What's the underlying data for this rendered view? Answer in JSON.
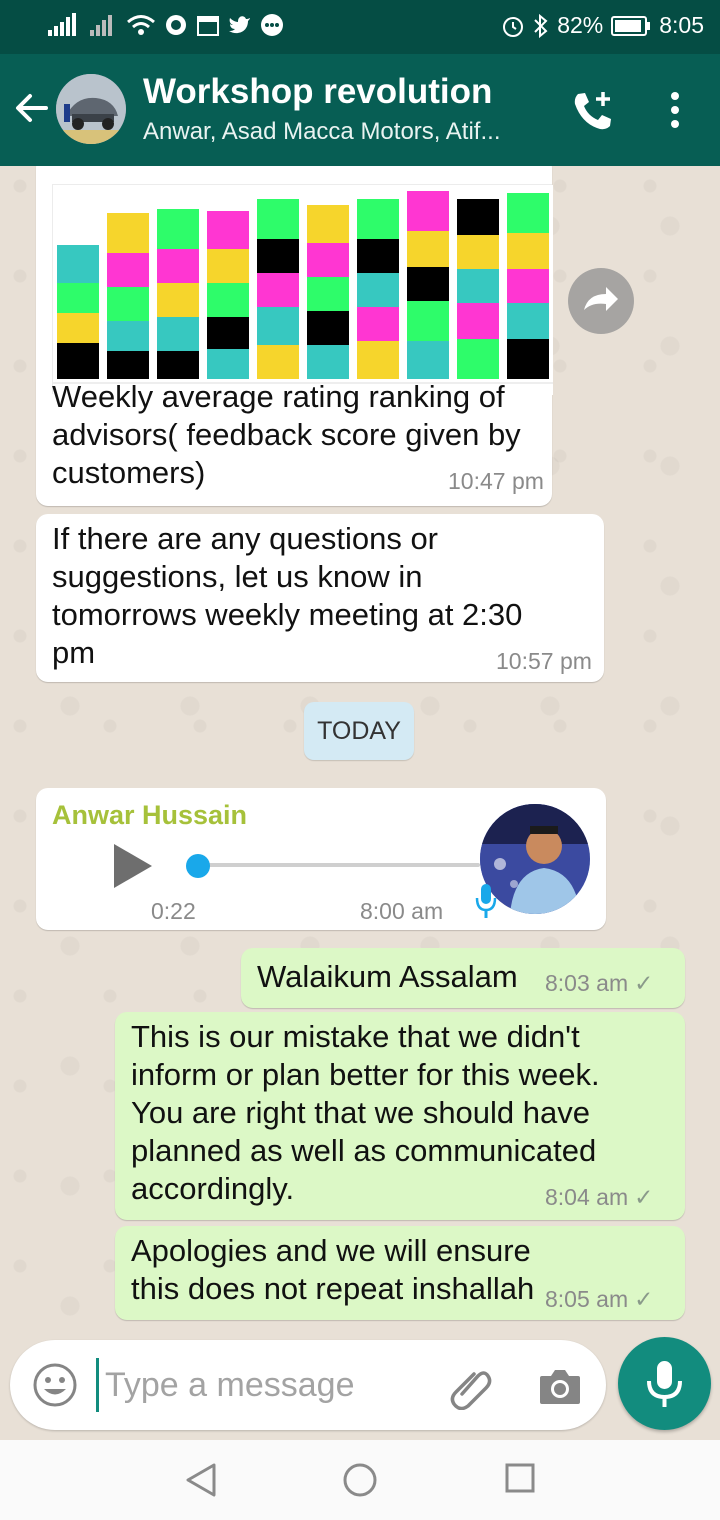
{
  "status_bar": {
    "battery": "82%",
    "time": "8:05"
  },
  "header": {
    "title": "Workshop revolution",
    "subtitle": "Anwar, Asad Macca Motors, Atif..."
  },
  "messages": {
    "image_caption": "Weekly average rating ranking of advisors( feedback score given by customers)",
    "image_time": "10:47 pm",
    "msg2_text": "If there are any questions or suggestions, let us know in tomorrows weekly meeting at 2:30 pm",
    "msg2_time": "10:57 pm",
    "date_divider": "TODAY",
    "voice_sender": "Anwar Hussain",
    "voice_duration": "0:22",
    "voice_time": "8:00 am",
    "out1_text": "Walaikum Assalam",
    "out1_time": "8:03 am",
    "out2_text": "This is our mistake that we didn't inform or plan better for this week. You are right that we should have planned as well as communicated accordingly.",
    "out2_time": "8:04 am",
    "out3_text": "Apologies and we will ensure this does not repeat inshallah",
    "out3_time": "8:05 am",
    "tick": "✓"
  },
  "input": {
    "placeholder": "Type a message"
  },
  "colors": {
    "header": "#075e54",
    "status_bar": "#054d44",
    "incoming_bubble": "#ffffff",
    "outgoing_bubble": "#dcf8c6",
    "sender_name": "#a6c13a",
    "mic_button": "#128c7e"
  }
}
